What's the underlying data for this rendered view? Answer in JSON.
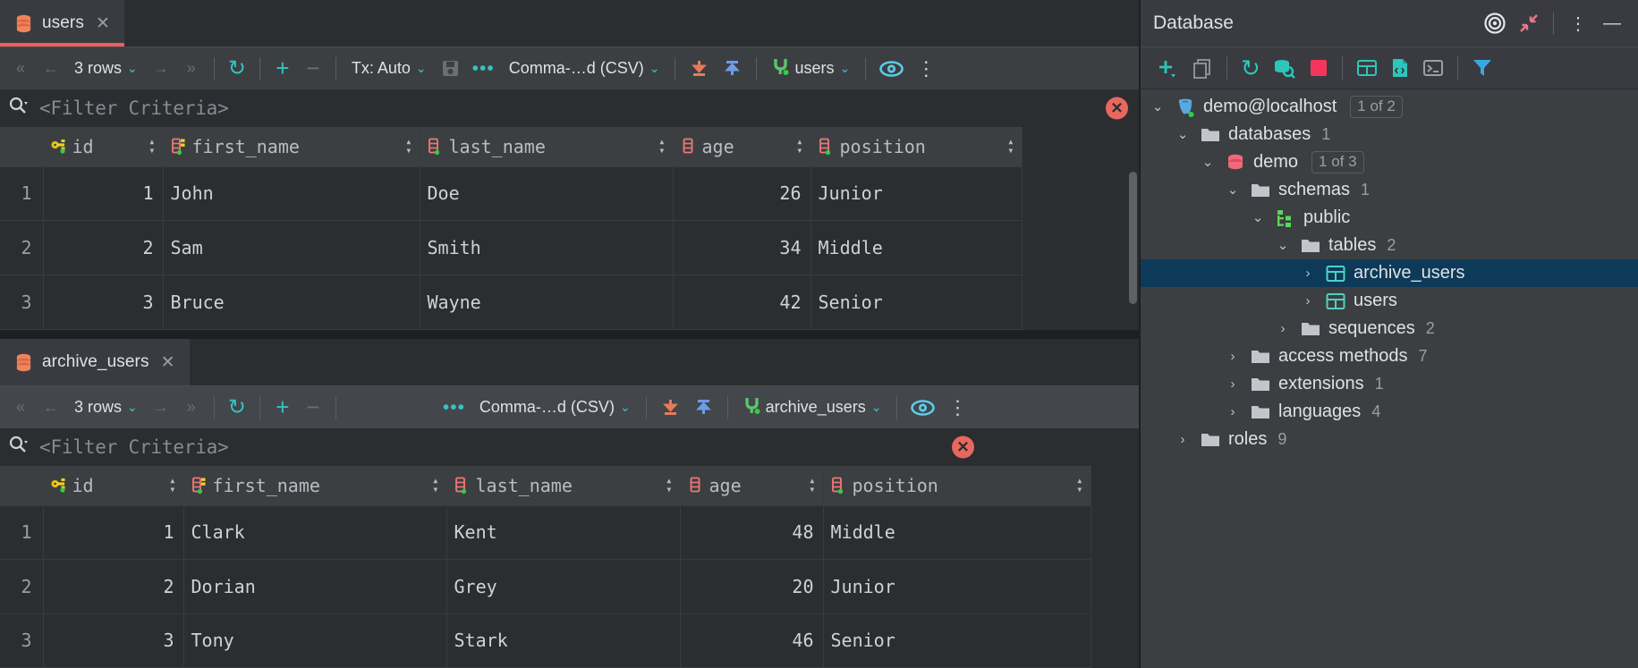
{
  "editor": {
    "panels": [
      {
        "tab": {
          "label": "users",
          "icon": "database-table-icon",
          "close": "✕",
          "selected": true
        },
        "toolbar": {
          "first_page": "«",
          "prev_page": "←",
          "rows_label": "3 rows",
          "rows_chevron": "⌄",
          "next_page": "→",
          "last_page": "»",
          "reload": "↻",
          "add_row": "+",
          "delete_row": "−",
          "tx_label": "Tx: Auto",
          "tx_chevron": "⌄",
          "commit": "save-icon",
          "more": "•••",
          "format_label": "Comma-…d (CSV)",
          "format_chevron": "⌄",
          "import": "download-icon",
          "export": "upload-icon",
          "session_label": "users",
          "session_chevron": "⌄",
          "view_options": "eye-icon",
          "overflow": "⋮"
        },
        "filter": {
          "placeholder": "<Filter Criteria>",
          "icon": "search-icon",
          "error": "✕"
        },
        "table": {
          "columns": [
            {
              "name": "id",
              "icon": "primary-key-icon",
              "type": "numeric"
            },
            {
              "name": "first_name",
              "icon": "text-column-icon",
              "type": "text"
            },
            {
              "name": "last_name",
              "icon": "text-column-icon",
              "type": "text"
            },
            {
              "name": "age",
              "icon": "numeric-column-icon",
              "type": "numeric"
            },
            {
              "name": "position",
              "icon": "text-column-icon",
              "type": "text"
            }
          ],
          "rows": [
            {
              "n": "1",
              "cells": [
                "1",
                "John",
                "Doe",
                "26",
                "Junior"
              ]
            },
            {
              "n": "2",
              "cells": [
                "2",
                "Sam",
                "Smith",
                "34",
                "Middle"
              ]
            },
            {
              "n": "3",
              "cells": [
                "3",
                "Bruce",
                "Wayne",
                "42",
                "Senior"
              ]
            }
          ]
        }
      },
      {
        "tab": {
          "label": "archive_users",
          "icon": "database-table-icon",
          "close": "✕",
          "selected": false
        },
        "toolbar": {
          "first_page": "«",
          "prev_page": "←",
          "rows_label": "3 rows",
          "rows_chevron": "⌄",
          "next_page": "→",
          "last_page": "»",
          "reload": "↻",
          "add_row": "+",
          "delete_row": "−",
          "more": "•••",
          "format_label": "Comma-…d (CSV)",
          "format_chevron": "⌄",
          "import": "download-icon",
          "export": "upload-icon",
          "session_label": "archive_users",
          "session_chevron": "⌄",
          "view_options": "eye-icon",
          "overflow": "⋮"
        },
        "filter": {
          "placeholder": "<Filter Criteria>",
          "icon": "search-icon",
          "error": "✕"
        },
        "table": {
          "columns": [
            {
              "name": "id",
              "icon": "primary-key-icon",
              "type": "numeric"
            },
            {
              "name": "first_name",
              "icon": "text-column-icon",
              "type": "text"
            },
            {
              "name": "last_name",
              "icon": "text-column-icon",
              "type": "text"
            },
            {
              "name": "age",
              "icon": "numeric-column-icon",
              "type": "numeric"
            },
            {
              "name": "position",
              "icon": "text-column-icon",
              "type": "text"
            }
          ],
          "rows": [
            {
              "n": "1",
              "cells": [
                "1",
                "Clark",
                "Kent",
                "48",
                "Middle"
              ]
            },
            {
              "n": "2",
              "cells": [
                "2",
                "Dorian",
                "Grey",
                "20",
                "Junior"
              ]
            },
            {
              "n": "3",
              "cells": [
                "3",
                "Tony",
                "Stark",
                "46",
                "Senior"
              ]
            }
          ]
        }
      }
    ]
  },
  "database_panel": {
    "title": "Database",
    "header_actions": [
      {
        "name": "locate-icon",
        "glyph": "◎"
      },
      {
        "name": "collapse-all-icon",
        "glyph": "↙"
      },
      {
        "name": "options-icon",
        "glyph": "⋮"
      },
      {
        "name": "hide-icon",
        "glyph": "—"
      }
    ],
    "toolbar_actions": [
      {
        "name": "new-icon",
        "glyph": "+"
      },
      {
        "name": "duplicate-icon",
        "glyph": "⧉"
      },
      {
        "name": "refresh-icon",
        "glyph": "↻"
      },
      {
        "name": "database-search-icon",
        "glyph": "⌾"
      },
      {
        "name": "stop-icon",
        "glyph": "■"
      },
      {
        "name": "data-editor-icon",
        "glyph": "▦"
      },
      {
        "name": "sql-file-icon",
        "glyph": "⬚"
      },
      {
        "name": "console-icon",
        "glyph": "⌫"
      },
      {
        "name": "filter-icon",
        "glyph": "▼"
      }
    ],
    "tree": [
      {
        "level": 0,
        "twisty": "⌄",
        "icon": "postgres-icon",
        "label": "demo@localhost",
        "badge": "1 of 2",
        "count": ""
      },
      {
        "level": 1,
        "twisty": "⌄",
        "icon": "folder-icon",
        "label": "databases",
        "badge": "",
        "count": "1"
      },
      {
        "level": 2,
        "twisty": "⌄",
        "icon": "db-icon",
        "label": "demo",
        "badge": "1 of 3",
        "count": ""
      },
      {
        "level": 3,
        "twisty": "⌄",
        "icon": "folder-icon",
        "label": "schemas",
        "badge": "",
        "count": "1"
      },
      {
        "level": 4,
        "twisty": "⌄",
        "icon": "schema-icon",
        "label": "public",
        "badge": "",
        "count": ""
      },
      {
        "level": 5,
        "twisty": "⌄",
        "icon": "folder-icon",
        "label": "tables",
        "badge": "",
        "count": "2"
      },
      {
        "level": 6,
        "twisty": "›",
        "icon": "table-icon",
        "label": "archive_users",
        "badge": "",
        "count": "",
        "selected": true
      },
      {
        "level": 6,
        "twisty": "›",
        "icon": "table-icon",
        "label": "users",
        "badge": "",
        "count": ""
      },
      {
        "level": 5,
        "twisty": "›",
        "icon": "folder-icon",
        "label": "sequences",
        "badge": "",
        "count": "2"
      },
      {
        "level": 3,
        "twisty": "›",
        "icon": "folder-icon",
        "label": "access methods",
        "badge": "",
        "count": "7"
      },
      {
        "level": 3,
        "twisty": "›",
        "icon": "folder-icon",
        "label": "extensions",
        "badge": "",
        "count": "1"
      },
      {
        "level": 3,
        "twisty": "›",
        "icon": "folder-icon",
        "label": "languages",
        "badge": "",
        "count": "4"
      },
      {
        "level": 1,
        "twisty": "›",
        "icon": "folder-icon",
        "label": "roles",
        "badge": "",
        "count": "9"
      }
    ]
  },
  "colors": {
    "accent_red": "#f05c5c",
    "accent_teal": "#35c3c3",
    "selection_blue": "#0d3a58",
    "panel_bg": "#3c3f41",
    "grid_bg": "#2b2d30"
  }
}
